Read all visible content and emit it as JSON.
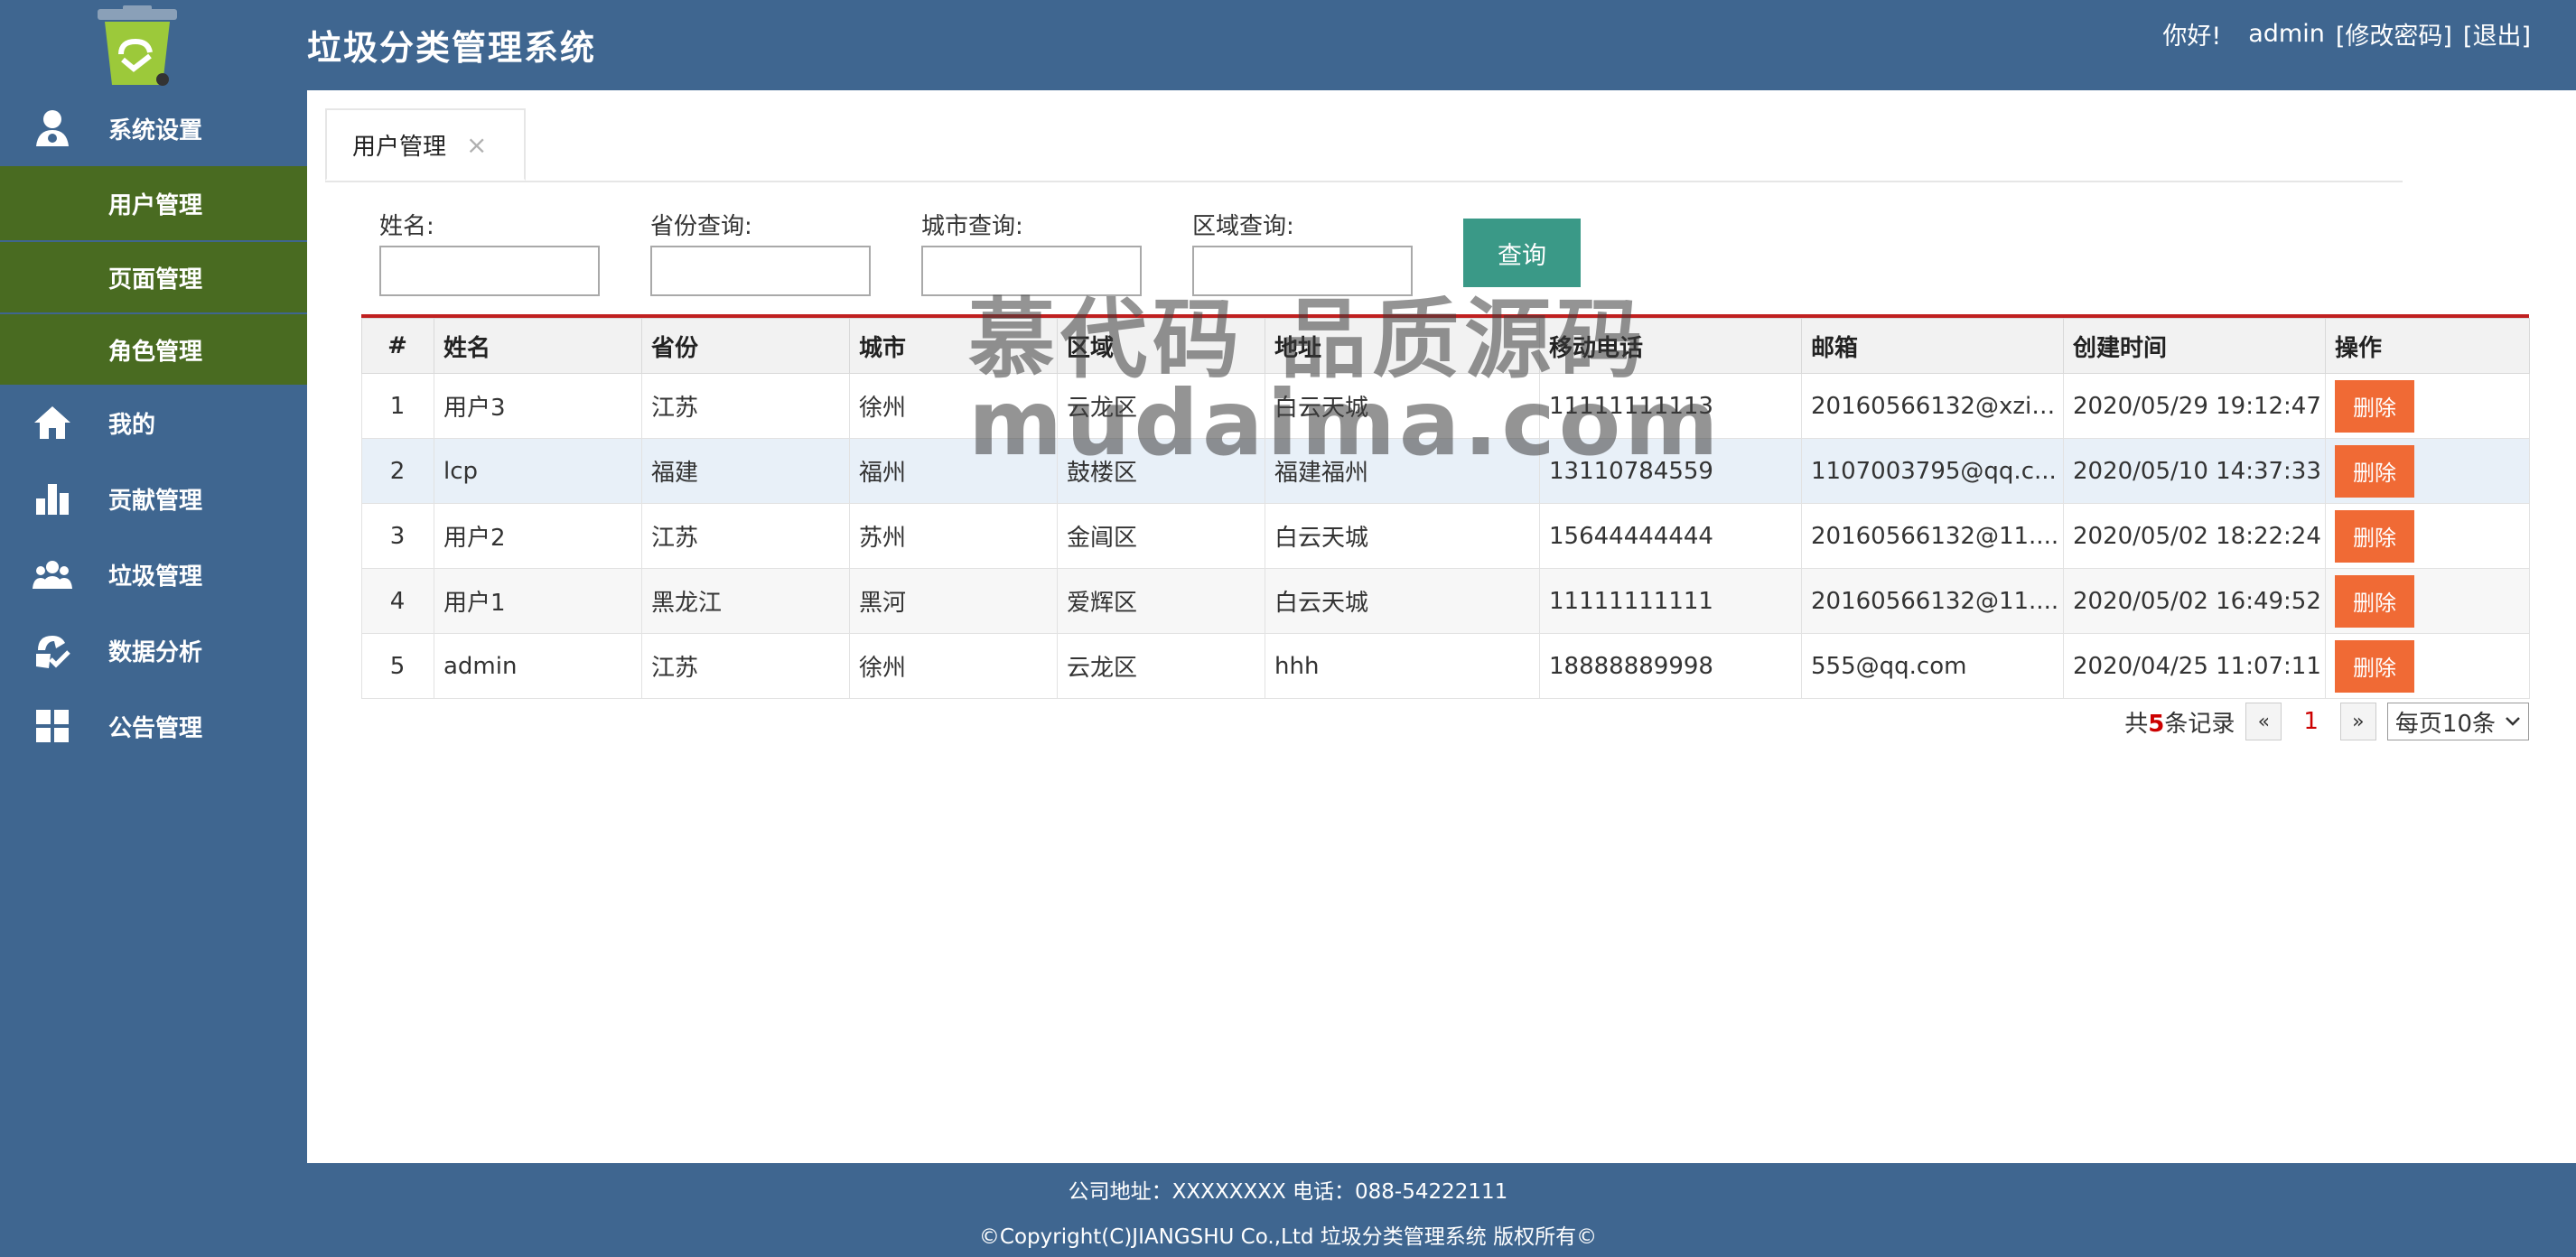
{
  "header": {
    "title": "垃圾分类管理系统",
    "greeting": "你好!",
    "username": "admin",
    "change_password": "[修改密码]",
    "logout": "[退出]"
  },
  "sidebar": {
    "system_settings": "系统设置",
    "sub_items": [
      "用户管理",
      "页面管理",
      "角色管理"
    ],
    "items": [
      "我的",
      "贡献管理",
      "垃圾管理",
      "数据分析",
      "公告管理"
    ]
  },
  "tab": {
    "label": "用户管理",
    "close": "×"
  },
  "filters": {
    "name_label": "姓名:",
    "province_label": "省份查询:",
    "city_label": "城市查询:",
    "district_label": "区域查询:",
    "query_button": "查询"
  },
  "table": {
    "headers": [
      "#",
      "姓名",
      "省份",
      "城市",
      "区域",
      "地址",
      "移动电话",
      "邮箱",
      "创建时间",
      "操作"
    ],
    "rows": [
      [
        "1",
        "用户3",
        "江苏",
        "徐州",
        "云龙区",
        "白云天城",
        "11111111113",
        "20160566132@xzit...",
        "2020/05/29 19:12:47",
        "删除"
      ],
      [
        "2",
        "lcp",
        "福建",
        "福州",
        "鼓楼区",
        "福建福州",
        "13110784559",
        "1107003795@qq.c...",
        "2020/05/10 14:37:33",
        "删除"
      ],
      [
        "3",
        "用户2",
        "江苏",
        "苏州",
        "金阊区",
        "白云天城",
        "15644444444",
        "20160566132@11....",
        "2020/05/02 18:22:24",
        "删除"
      ],
      [
        "4",
        "用户1",
        "黑龙江",
        "黑河",
        "爱辉区",
        "白云天城",
        "11111111111",
        "20160566132@11....",
        "2020/05/02 16:49:52",
        "删除"
      ],
      [
        "5",
        "admin",
        "江苏",
        "徐州",
        "云龙区",
        "hhh",
        "18888889998",
        "555@qq.com",
        "2020/04/25 11:07:11",
        "删除"
      ]
    ]
  },
  "pager": {
    "prefix": "共",
    "count": "5",
    "suffix": "条记录",
    "prev": "«",
    "current": "1",
    "next": "»",
    "per_page": "每页10条"
  },
  "watermark": {
    "line1": "慕代码 品质源码",
    "line2": "mudaima.com"
  },
  "footer": {
    "line1": "公司地址：XXXXXXXX 电话：088-54222111",
    "line2": "©Copyright(C)JIANGSHU Co.,Ltd 垃圾分类管理系统 版权所有©"
  },
  "colors": {
    "primary": "#3f6690",
    "submenu": "#496b21",
    "query_button": "#3a9987",
    "delete_button": "#f06a35"
  }
}
